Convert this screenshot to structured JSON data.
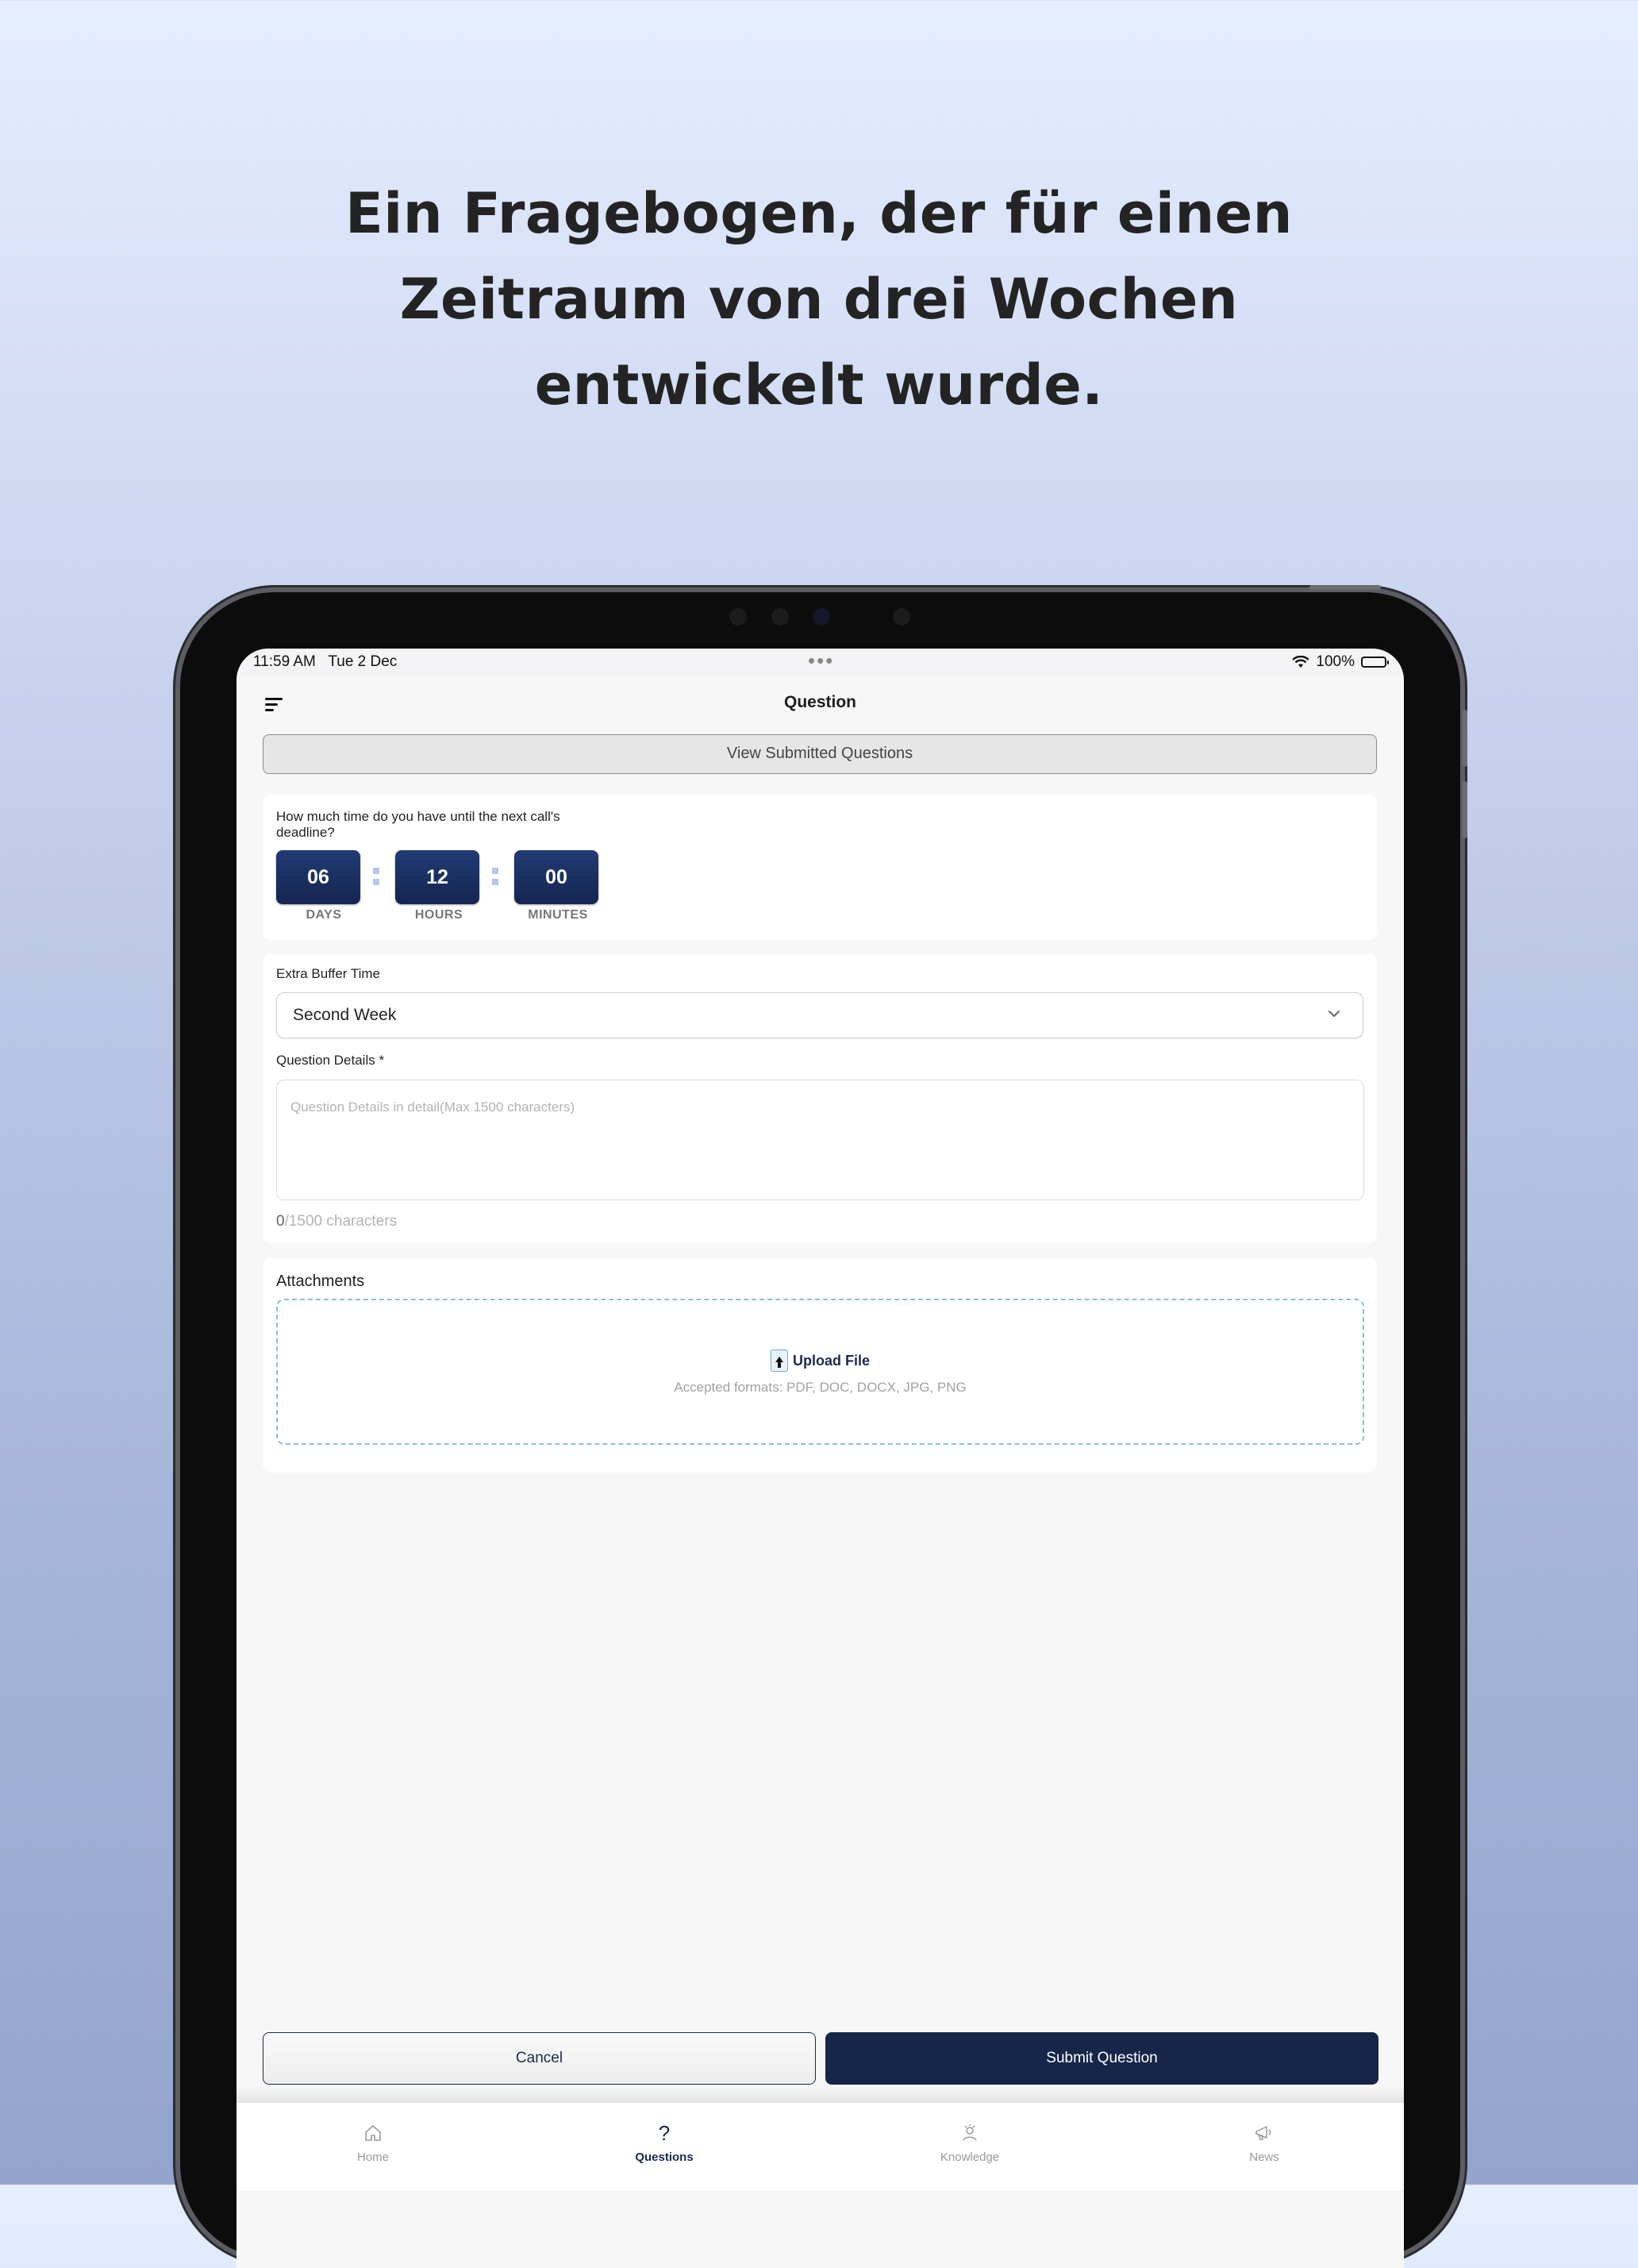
{
  "headline": {
    "line1": "Ein Fragebogen, der für einen",
    "line2": "Zeitraum von drei Wochen",
    "line3": "entwickelt wurde."
  },
  "status_bar": {
    "time": "11:59 AM   Tue 2 Dec",
    "dots": "•••",
    "battery": "100%"
  },
  "nav": {
    "title": "Question"
  },
  "view_submitted_label": "View Submitted Questions",
  "countdown": {
    "question": "How much time do you have until the next call's deadline?",
    "days": "06",
    "hours": "12",
    "minutes": "00",
    "days_label": "DAYS",
    "hours_label": "HOURS",
    "minutes_label": "MINUTES"
  },
  "form": {
    "buffer_label": "Extra Buffer Time",
    "buffer_value": "Second Week",
    "details_label": "Question Details *",
    "details_placeholder": "Question Details in detail(Max 1500 characters)",
    "char_count": "0",
    "char_max": "/1500 characters"
  },
  "attachments": {
    "title": "Attachments",
    "upload_label": "Upload File",
    "formats": "Accepted formats: PDF, DOC, DOCX, JPG, PNG"
  },
  "actions": {
    "cancel": "Cancel",
    "submit": "Submit Question"
  },
  "tabs": [
    {
      "label": "Home",
      "icon": "home-icon"
    },
    {
      "label": "Questions",
      "icon": "question-icon",
      "active": true
    },
    {
      "label": "Knowledge",
      "icon": "knowledge-icon"
    },
    {
      "label": "News",
      "icon": "news-icon"
    }
  ],
  "colors": {
    "navy": "#162649",
    "dashed_border": "#8cc0d6"
  }
}
